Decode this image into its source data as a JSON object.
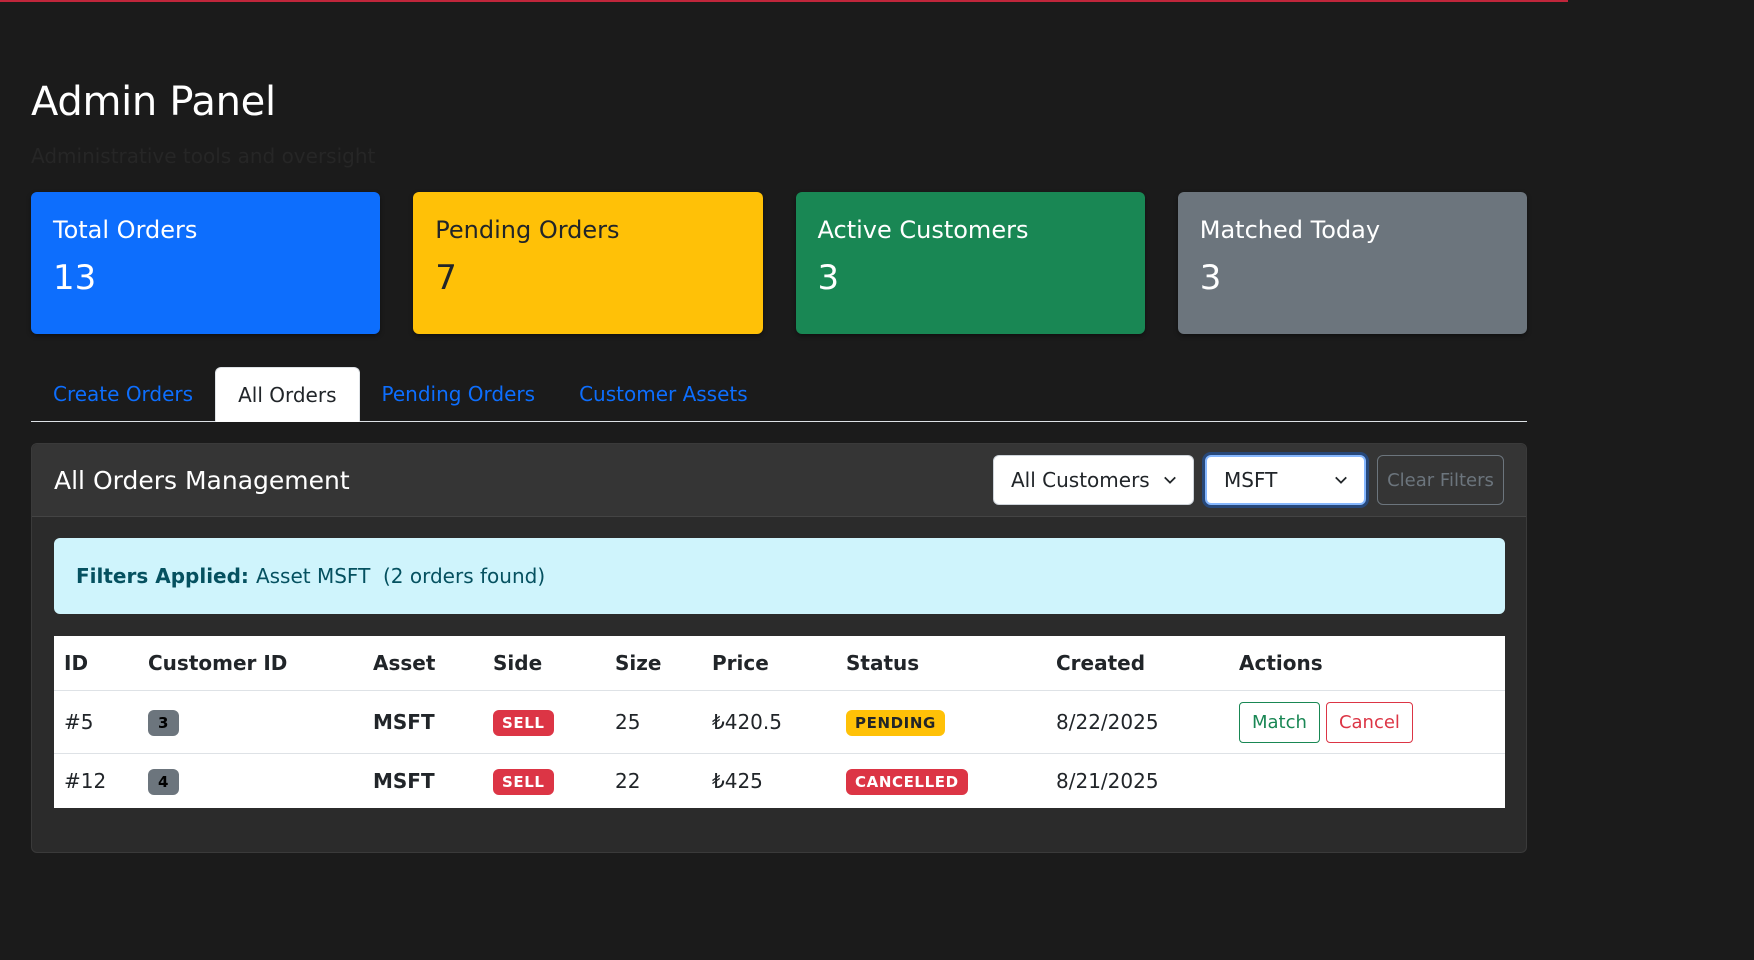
{
  "page": {
    "title": "Admin Panel",
    "subtitle": "Administrative tools and oversight"
  },
  "stats": [
    {
      "label": "Total Orders",
      "value": "13",
      "color": "#0d6efd"
    },
    {
      "label": "Pending Orders",
      "value": "7",
      "color": "#ffc107"
    },
    {
      "label": "Active Customers",
      "value": "3",
      "color": "#198754"
    },
    {
      "label": "Matched Today",
      "value": "3",
      "color": "#6c757d"
    }
  ],
  "tabs": [
    {
      "label": "Create Orders"
    },
    {
      "label": "All Orders",
      "active": true
    },
    {
      "label": "Pending Orders"
    },
    {
      "label": "Customer Assets"
    }
  ],
  "card": {
    "title": "All Orders Management",
    "customer_filter": "All Customers",
    "asset_filter": "MSFT",
    "clear_label": "Clear Filters"
  },
  "alert": {
    "label": "Filters Applied:",
    "text": "Asset MSFT  (2 orders found)"
  },
  "table": {
    "headers": [
      "ID",
      "Customer ID",
      "Asset",
      "Side",
      "Size",
      "Price",
      "Status",
      "Created",
      "Actions"
    ],
    "rows": [
      {
        "id": "#5",
        "customer": "3",
        "asset": "MSFT",
        "side": "SELL",
        "size": "25",
        "price": "₺420.5",
        "status": "PENDING",
        "created": "8/22/2025",
        "actions": [
          "Match",
          "Cancel"
        ]
      },
      {
        "id": "#12",
        "customer": "4",
        "asset": "MSFT",
        "side": "SELL",
        "size": "22",
        "price": "₺425",
        "status": "CANCELLED",
        "created": "8/21/2025",
        "actions": []
      }
    ]
  }
}
